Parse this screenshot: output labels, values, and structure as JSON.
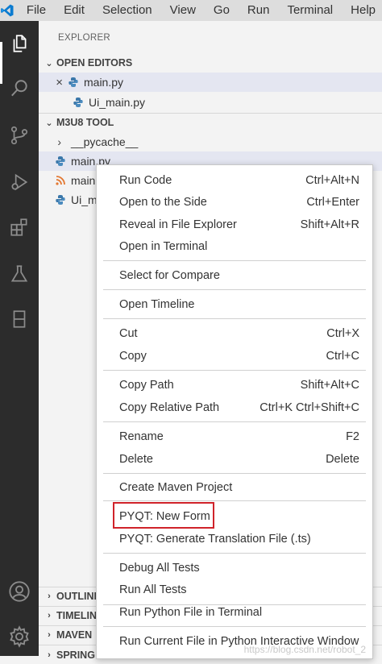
{
  "menubar": {
    "items": [
      "File",
      "Edit",
      "Selection",
      "View",
      "Go",
      "Run",
      "Terminal",
      "Help"
    ]
  },
  "activitybar": {
    "icons": [
      "explorer-icon",
      "search-icon",
      "source-control-icon",
      "run-debug-icon",
      "extensions-icon",
      "testing-icon",
      "remote-icon",
      "account-icon",
      "settings-gear-icon"
    ]
  },
  "sidebar": {
    "title": "EXPLORER",
    "open_editors": {
      "header": "OPEN EDITORS",
      "items": [
        {
          "label": "main.py",
          "selected": true,
          "close": "×"
        },
        {
          "label": "Ui_main.py"
        }
      ]
    },
    "project": {
      "header": "M3U8 TOOL",
      "items": [
        {
          "label": "__pycache__",
          "type": "folder"
        },
        {
          "label": "main.py",
          "type": "python"
        },
        {
          "label": "main",
          "type": "rss"
        },
        {
          "label": "Ui_m",
          "type": "python"
        }
      ]
    },
    "bottom_sections": [
      "OUTLINE",
      "TIMELINE",
      "MAVEN",
      "SPRING"
    ]
  },
  "context_menu": {
    "items": [
      {
        "label": "Run Code",
        "shortcut": "Ctrl+Alt+N"
      },
      {
        "label": "Open to the Side",
        "shortcut": "Ctrl+Enter"
      },
      {
        "label": "Reveal in File Explorer",
        "shortcut": "Shift+Alt+R"
      },
      {
        "label": "Open in Terminal",
        "shortcut": ""
      },
      {
        "label": "Select for Compare",
        "shortcut": ""
      },
      {
        "label": "Open Timeline",
        "shortcut": ""
      },
      {
        "label": "Cut",
        "shortcut": "Ctrl+X"
      },
      {
        "label": "Copy",
        "shortcut": "Ctrl+C"
      },
      {
        "label": "Copy Path",
        "shortcut": "Shift+Alt+C"
      },
      {
        "label": "Copy Relative Path",
        "shortcut": "Ctrl+K Ctrl+Shift+C"
      },
      {
        "label": "Rename",
        "shortcut": "F2"
      },
      {
        "label": "Delete",
        "shortcut": "Delete"
      },
      {
        "label": "Create Maven Project",
        "shortcut": ""
      },
      {
        "label": "PYQT: New Form",
        "shortcut": ""
      },
      {
        "label": "PYQT: Generate Translation File (.ts)",
        "shortcut": ""
      },
      {
        "label": "Debug All Tests",
        "shortcut": ""
      },
      {
        "label": "Run All Tests",
        "shortcut": ""
      },
      {
        "label": "Run Python File in Terminal",
        "shortcut": ""
      },
      {
        "label": "Run Current File in Python Interactive Window",
        "shortcut": ""
      }
    ]
  },
  "watermark": "https://blog.csdn.net/robot_2",
  "colors": {
    "accent_highlight": "#d0232a",
    "activitybar": "#2c2c2c",
    "vscode_blue": "#007acc"
  }
}
